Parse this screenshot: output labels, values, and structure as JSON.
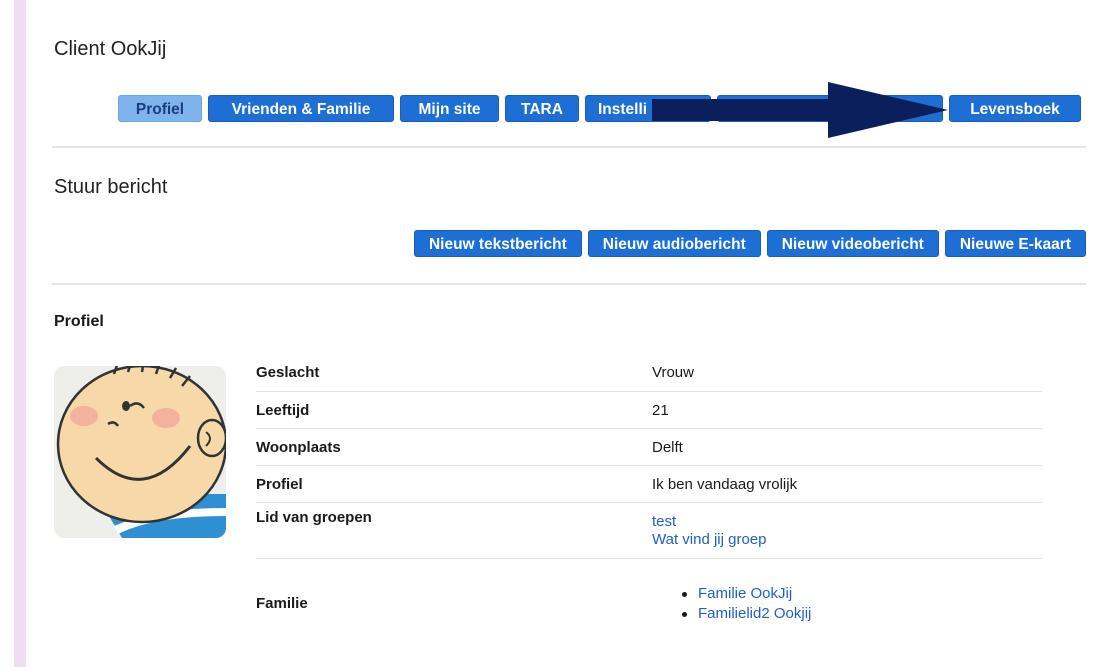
{
  "page": {
    "title": "Client OokJij"
  },
  "tabs": [
    {
      "label": "Profiel",
      "active": true
    },
    {
      "label": "Vrienden & Familie"
    },
    {
      "label": "Mijn site"
    },
    {
      "label": "TARA"
    },
    {
      "label": "Instelli"
    },
    {
      "label": ""
    },
    {
      "label": "Levensboek"
    }
  ],
  "message_section": {
    "title": "Stuur bericht",
    "buttons": [
      "Nieuw tekstbericht",
      "Nieuw audiobericht",
      "Nieuw videobericht",
      "Nieuwe E-kaart"
    ]
  },
  "profile": {
    "heading": "Profiel",
    "rows": [
      {
        "label": "Geslacht",
        "value": "Vrouw"
      },
      {
        "label": "Leeftijd",
        "value": "21"
      },
      {
        "label": "Woonplaats",
        "value": "Delft"
      },
      {
        "label": "Profiel",
        "value": "Ik ben vandaag vrolijk"
      }
    ],
    "groups": {
      "label": "Lid van groepen",
      "items": [
        "test",
        "Wat vind jij groep"
      ]
    },
    "family": {
      "label": "Familie",
      "items": [
        "Familie OokJij",
        "Familielid2 Ookjij"
      ]
    }
  },
  "colors": {
    "button": "#1e6fd5",
    "button_active": "#7fb3ee",
    "arrow": "#0b1f5c",
    "sidebar": "#f1dcf3",
    "link": "#1f5fc9"
  }
}
